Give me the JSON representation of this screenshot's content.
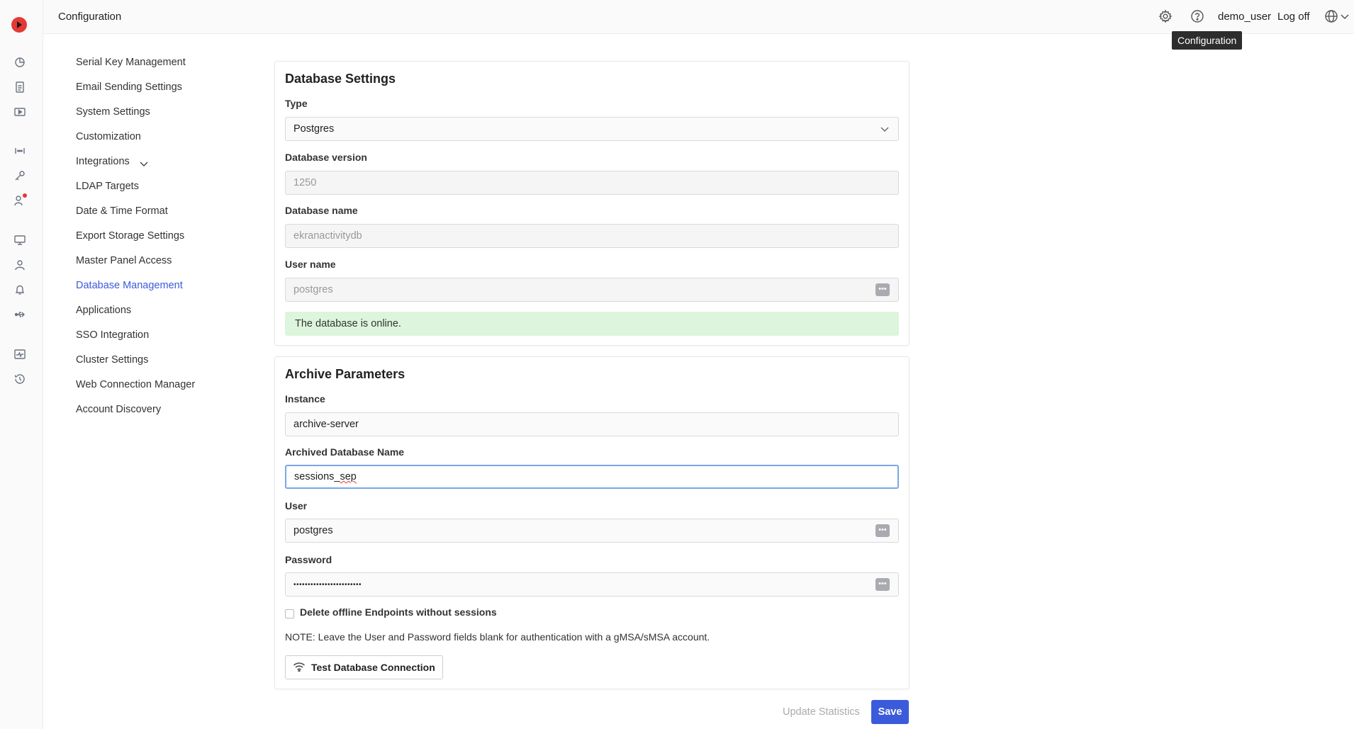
{
  "header": {
    "title": "Configuration",
    "username": "demo_user",
    "logoff_label": "Log off",
    "tooltip": "Configuration"
  },
  "settings_nav": {
    "items": [
      {
        "label": "Serial Key Management"
      },
      {
        "label": "Email Sending Settings"
      },
      {
        "label": "System Settings"
      },
      {
        "label": "Customization"
      },
      {
        "label": "Integrations"
      },
      {
        "label": "LDAP Targets"
      },
      {
        "label": "Date & Time Format"
      },
      {
        "label": "Export Storage Settings"
      },
      {
        "label": "Master Panel Access"
      },
      {
        "label": "Database Management"
      },
      {
        "label": "Applications"
      },
      {
        "label": "SSO Integration"
      },
      {
        "label": "Cluster Settings"
      },
      {
        "label": "Web Connection Manager"
      },
      {
        "label": "Account Discovery"
      }
    ],
    "active": "Database Management"
  },
  "database_settings": {
    "title": "Database Settings",
    "type_label": "Type",
    "type_value": "Postgres",
    "version_label": "Database version",
    "version_value": "1250",
    "name_label": "Database name",
    "name_value": "ekranactivitydb",
    "username_label": "User name",
    "username_value": "postgres",
    "status": "The database is online."
  },
  "archive_parameters": {
    "title": "Archive Parameters",
    "instance_label": "Instance",
    "instance_value": "archive-server",
    "archived_db_label": "Archived Database Name",
    "archived_db_value_a": "sessions_",
    "archived_db_value_b": "sep",
    "user_label": "User",
    "user_value": "postgres",
    "password_label": "Password",
    "password_value": "••••••••••••••••••••••••",
    "delete_offline_label": "Delete offline Endpoints without sessions",
    "delete_offline_checked": false,
    "note": "NOTE: Leave the User and Password fields blank for authentication with a gMSA/sMSA account.",
    "test_button": "Test Database Connection"
  },
  "footer": {
    "update_stats": "Update Statistics",
    "save": "Save"
  },
  "colors": {
    "accent": "#3b5bdb",
    "online_bg": "#dcf5dc",
    "rail_alert": "#e53935"
  },
  "icons": {
    "rail": [
      "logo-icon",
      "dashboard-icon",
      "reports-icon",
      "video-icon",
      "privileged-access-icon",
      "key-icon",
      "user-alert-icon",
      "monitor-icon",
      "user-icon",
      "bell-icon",
      "usb-icon",
      "health-icon",
      "history-icon"
    ],
    "header": [
      "gear-icon",
      "help-icon",
      "globe-icon",
      "chevron-down-icon"
    ]
  }
}
